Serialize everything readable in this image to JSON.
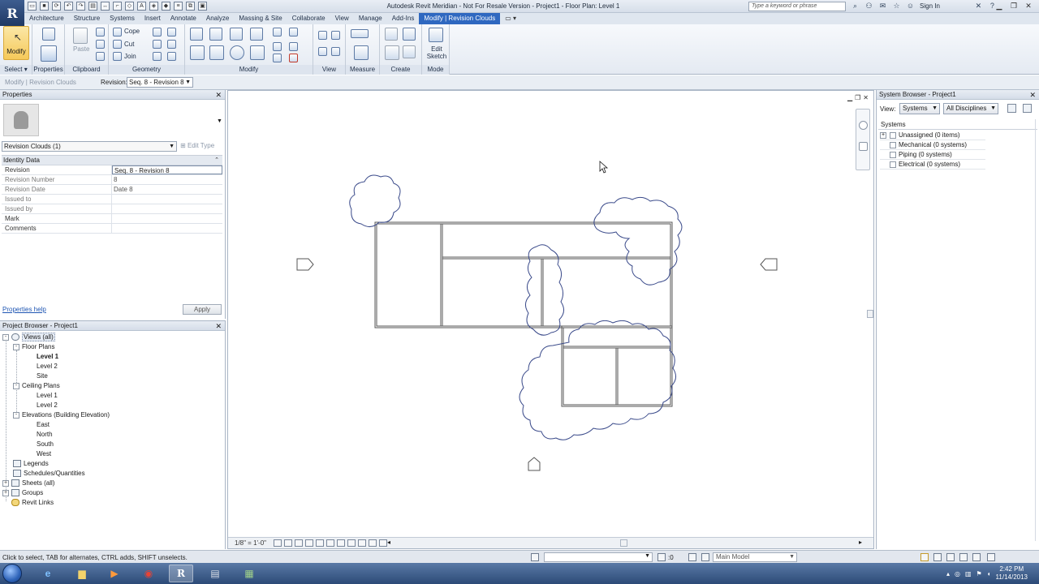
{
  "title": {
    "app_letter": "R",
    "text": "Autodesk Revit Meridian - Not For Resale Version -     Project1 - Floor Plan: Level 1",
    "search_placeholder": "Type a keyword or phrase",
    "sign_in": "Sign In"
  },
  "tabs": [
    {
      "label": "Architecture"
    },
    {
      "label": "Structure"
    },
    {
      "label": "Systems"
    },
    {
      "label": "Insert"
    },
    {
      "label": "Annotate"
    },
    {
      "label": "Analyze"
    },
    {
      "label": "Massing & Site"
    },
    {
      "label": "Collaborate"
    },
    {
      "label": "View"
    },
    {
      "label": "Manage"
    },
    {
      "label": "Add-Ins"
    },
    {
      "label": "Modify | Revision Clouds"
    }
  ],
  "ribbon": {
    "modify_label": "Modify",
    "paste_label": "Paste",
    "cope_label": "Cope",
    "cut_label": "Cut",
    "join_label": "Join",
    "edit_sketch_label": "Edit\nSketch",
    "panels": {
      "select": "Select",
      "properties": "Properties",
      "clipboard": "Clipboard",
      "geometry": "Geometry",
      "modify": "Modify",
      "view": "View",
      "measure": "Measure",
      "create": "Create",
      "mode": "Mode"
    }
  },
  "options_bar": {
    "context": "Modify | Revision Clouds",
    "revision_label": "Revision:",
    "revision_value": "Seq. 8 - Revision 8"
  },
  "properties": {
    "header": "Properties",
    "type_selector": "Revision Clouds (1)",
    "edit_type": "Edit Type",
    "group": "Identity Data",
    "rows": [
      {
        "key": "Revision",
        "value": "Seq. 8 - Revision 8"
      },
      {
        "key": "Revision Number",
        "value": "8"
      },
      {
        "key": "Revision Date",
        "value": "Date 8"
      },
      {
        "key": "Issued to",
        "value": ""
      },
      {
        "key": "Issued by",
        "value": ""
      },
      {
        "key": "Mark",
        "value": ""
      },
      {
        "key": "Comments",
        "value": ""
      }
    ],
    "help_link": "Properties help",
    "apply": "Apply"
  },
  "project_browser": {
    "header": "Project Browser - Project1",
    "items": [
      {
        "label": "Views (all)"
      },
      {
        "label": "Floor Plans"
      },
      {
        "label": "Level 1"
      },
      {
        "label": "Level 2"
      },
      {
        "label": "Site"
      },
      {
        "label": "Ceiling Plans"
      },
      {
        "label": "Level 1"
      },
      {
        "label": "Level 2"
      },
      {
        "label": "Elevations (Building Elevation)"
      },
      {
        "label": "East"
      },
      {
        "label": "North"
      },
      {
        "label": "South"
      },
      {
        "label": "West"
      },
      {
        "label": "Legends"
      },
      {
        "label": "Schedules/Quantities"
      },
      {
        "label": "Sheets (all)"
      },
      {
        "label": "Groups"
      },
      {
        "label": "Revit Links"
      }
    ]
  },
  "canvas": {
    "scale": "1/8\" = 1'-0\""
  },
  "system_browser": {
    "header": "System Browser - Project1",
    "view_label": "View:",
    "view_value": "Systems",
    "discipline_value": "All Disciplines",
    "column_header": "Systems",
    "rows": [
      {
        "label": "Unassigned (0 items)"
      },
      {
        "label": "Mechanical (0 systems)"
      },
      {
        "label": "Piping (0 systems)"
      },
      {
        "label": "Electrical (0 systems)"
      }
    ]
  },
  "status_bar": {
    "text": "Click to select, TAB for alternates, CTRL adds, SHIFT unselects.",
    "workset_value": ":0",
    "model": "Main Model"
  },
  "taskbar": {
    "time": "2:42 PM",
    "date": "11/14/2013"
  },
  "colors": {
    "accent": "#2f68c0",
    "cloud": "#3a4a8a",
    "link": "#1f56b3"
  }
}
